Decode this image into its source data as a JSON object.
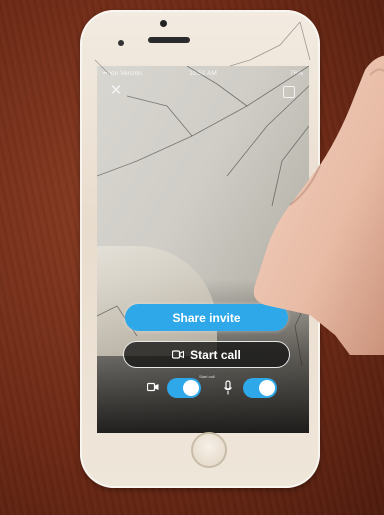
{
  "status_bar": {
    "carrier": "••ooo Verizon",
    "time": "10:51 AM",
    "battery": "76%"
  },
  "share_invite_label": "Share invite",
  "start_call_label": "Start call",
  "small_label": "Start call",
  "colors": {
    "accent": "#2ea8e8",
    "phone_body": "#efe6da",
    "table": "#6e2a16"
  },
  "icons": [
    "close-icon",
    "copy-icon",
    "video-camera-icon",
    "microphone-icon"
  ]
}
